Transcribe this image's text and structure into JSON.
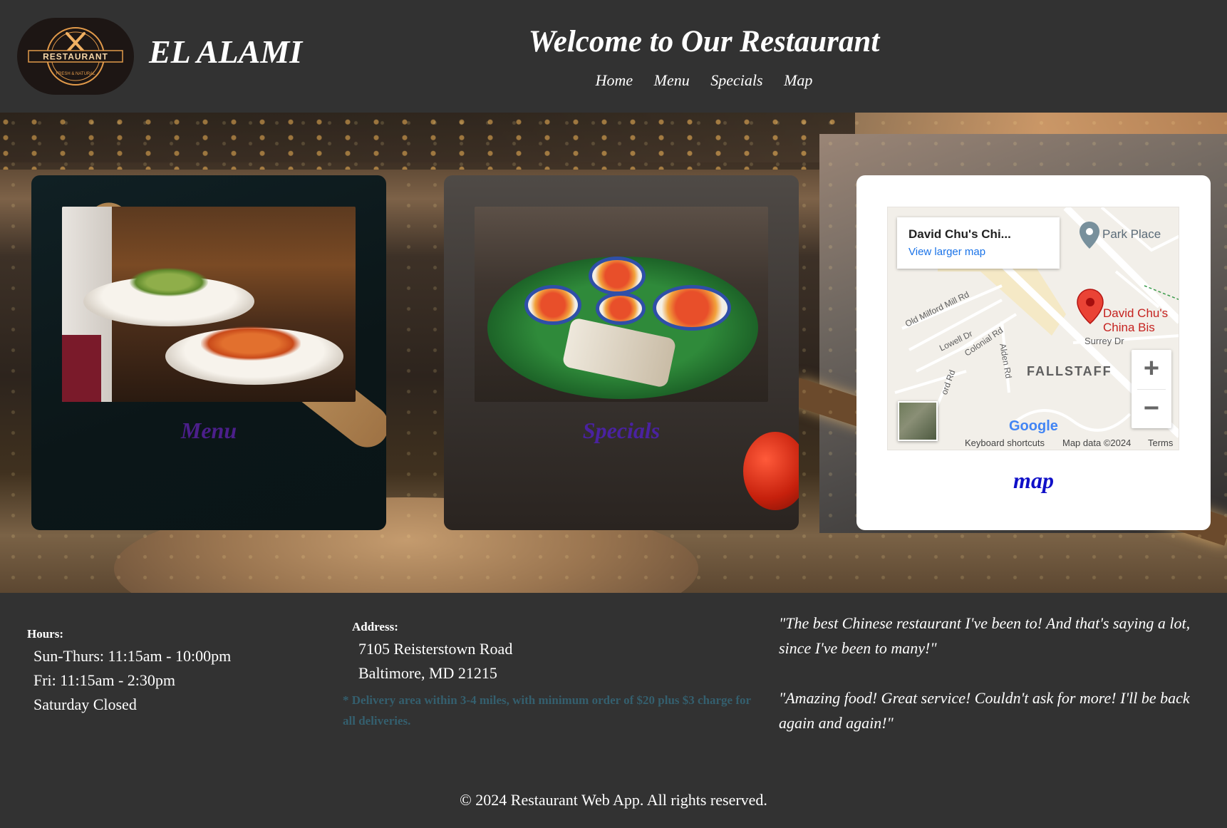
{
  "header": {
    "brand": "EL ALAMI",
    "welcome": "Welcome to Our Restaurant",
    "logo_text": "RESTAURANT",
    "logo_subtext": "FRESH & NATURAL",
    "nav": [
      "Home",
      "Menu",
      "Specials",
      "Map"
    ]
  },
  "cards": {
    "menu": {
      "title": "Menu"
    },
    "specials": {
      "title": "Specials"
    },
    "map": {
      "caption": "map",
      "info_title": "David Chu's Chi...",
      "info_link": "View larger map",
      "pin_label": "David Chu's China Bis",
      "labels": {
        "park_place": "Park Place",
        "old_milford": "Old Milford Mill Rd",
        "lowell": "Lowell Dr",
        "colonial": "Colonial Rd",
        "alden": "Alden Rd",
        "surrey": "Surrey Dr",
        "fallstaff": "FALLSTAFF",
        "ord_rd": "ord Rd"
      },
      "zoom_in": "+",
      "zoom_out": "−",
      "google": "Google",
      "footer": {
        "shortcuts": "Keyboard shortcuts",
        "mapdata": "Map data ©2024",
        "terms": "Terms"
      }
    }
  },
  "hours": {
    "label": "Hours:",
    "lines": [
      "Sun-Thurs: 11:15am - 10:00pm",
      "Fri: 11:15am - 2:30pm",
      "Saturday Closed"
    ]
  },
  "address": {
    "label": "Address:",
    "street": "7105 Reisterstown Road",
    "city": "Baltimore, MD 21215",
    "delivery": "* Delivery area within 3-4 miles, with minimum order of $20 plus $3 charge for all deliveries."
  },
  "reviews": [
    "\"The best Chinese restaurant I've been to! And that's saying a lot, since I've been to many!\"",
    "\"Amazing food! Great service! Couldn't ask for more! I'll be back again and again!\""
  ],
  "copyright": "© 2024 Restaurant Web App. All rights reserved.",
  "colors": {
    "background": "#323232",
    "menu_title": "#4b1f8a",
    "map_caption": "#1010c8",
    "delivery_note": "#345f6e",
    "map_link": "#1a73e8",
    "pin": "#ea4335"
  }
}
